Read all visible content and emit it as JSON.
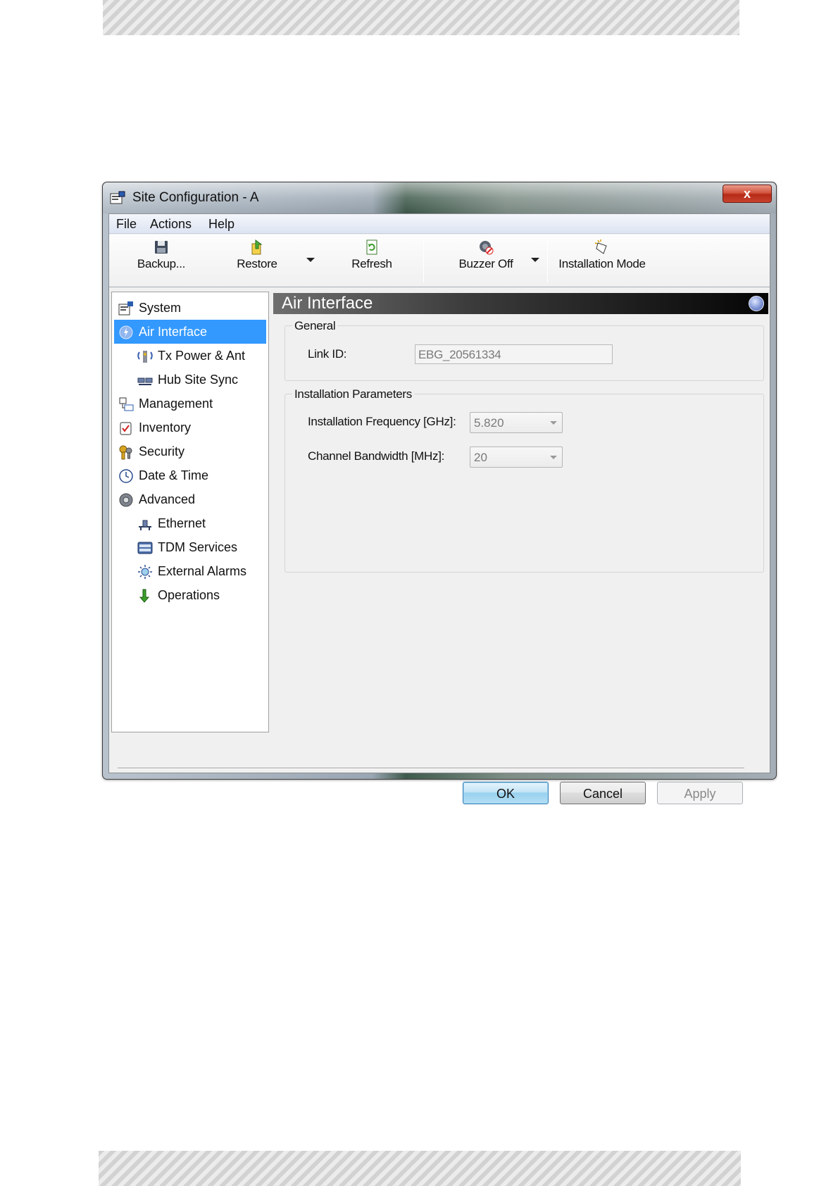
{
  "window": {
    "title": "Site Configuration - A",
    "close_label": "x"
  },
  "menu": {
    "items": [
      "File",
      "Actions",
      "Help"
    ]
  },
  "toolbar": {
    "backup_label": "Backup...",
    "restore_label": "Restore",
    "refresh_label": "Refresh",
    "buzzer_label": "Buzzer Off",
    "installation_label": "Installation Mode"
  },
  "sidebar": {
    "items": [
      {
        "label": "System",
        "icon": "system-icon"
      },
      {
        "label": "Air Interface",
        "icon": "air-interface-icon",
        "selected": true
      },
      {
        "label": "Tx Power & Ant",
        "icon": "tx-power-icon"
      },
      {
        "label": "Hub Site Sync",
        "icon": "hub-sync-icon"
      },
      {
        "label": "Management",
        "icon": "management-icon"
      },
      {
        "label": "Inventory",
        "icon": "inventory-icon"
      },
      {
        "label": "Security",
        "icon": "security-icon"
      },
      {
        "label": "Date & Time",
        "icon": "clock-icon"
      },
      {
        "label": "Advanced",
        "icon": "gear-icon"
      },
      {
        "label": "Ethernet",
        "icon": "ethernet-icon"
      },
      {
        "label": "TDM Services",
        "icon": "tdm-icon"
      },
      {
        "label": "External Alarms",
        "icon": "alarm-icon"
      },
      {
        "label": "Operations",
        "icon": "operations-icon"
      }
    ]
  },
  "panel": {
    "title": "Air Interface",
    "general": {
      "title": "General",
      "link_id_label": "Link ID:",
      "link_id_value": "EBG_20561334"
    },
    "installation": {
      "title": "Installation Parameters",
      "frequency_label": "Installation Frequency [GHz]:",
      "frequency_value": "5.820",
      "bandwidth_label": "Channel Bandwidth [MHz]:",
      "bandwidth_value": "20"
    }
  },
  "buttons": {
    "ok": "OK",
    "cancel": "Cancel",
    "apply": "Apply"
  },
  "colors": {
    "selection": "#3399ff",
    "close_button": "#c8432e"
  }
}
